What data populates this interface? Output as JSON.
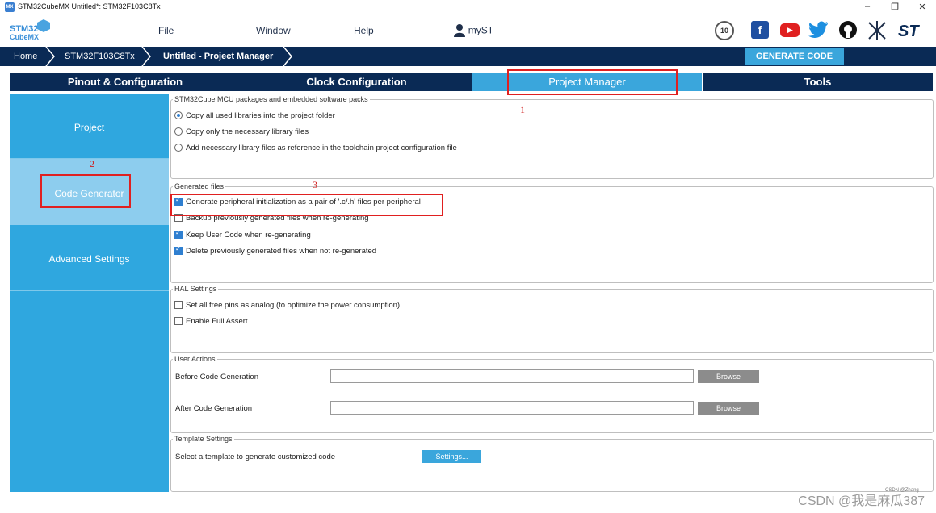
{
  "window": {
    "title": "STM32CubeMX Untitled*: STM32F103C8Tx",
    "app_icon": "MX",
    "controls": {
      "minimize": "–",
      "restore": "❐",
      "close": "✕"
    }
  },
  "menubar": {
    "logo_top": "STM32",
    "logo_bottom": "CubeMX",
    "items": [
      "File",
      "Window",
      "Help"
    ],
    "myst_label": "myST",
    "social_icons": [
      "anniversary-badge-icon",
      "facebook-icon",
      "youtube-icon",
      "twitter-icon",
      "github-icon",
      "network-icon",
      "st-logo-icon"
    ],
    "badge_text": "10"
  },
  "breadcrumb": {
    "items": [
      "Home",
      "STM32F103C8Tx",
      "Untitled - Project Manager"
    ]
  },
  "generate_button": "GENERATE CODE",
  "tabs": [
    {
      "label": "Pinout & Configuration",
      "active": false
    },
    {
      "label": "Clock Configuration",
      "active": false
    },
    {
      "label": "Project Manager",
      "active": true
    },
    {
      "label": "Tools",
      "active": false
    }
  ],
  "sidebar": {
    "items": [
      "Project",
      "Code Generator",
      "Advanced Settings"
    ],
    "active_index": 1
  },
  "packages": {
    "title": "STM32Cube MCU packages and embedded software packs",
    "options": [
      {
        "label": "Copy all used libraries into the project folder",
        "selected": true
      },
      {
        "label": "Copy only the necessary library files",
        "selected": false
      },
      {
        "label": "Add necessary library files as reference in the toolchain project configuration file",
        "selected": false
      }
    ]
  },
  "generated_files": {
    "title": "Generated files",
    "options": [
      {
        "label": "Generate peripheral initialization as a pair of '.c/.h' files per peripheral",
        "checked": true
      },
      {
        "label": "Backup previously generated files when re-generating",
        "checked": false
      },
      {
        "label": "Keep User Code when re-generating",
        "checked": true
      },
      {
        "label": "Delete previously generated files when not re-generated",
        "checked": true
      }
    ]
  },
  "hal_settings": {
    "title": "HAL Settings",
    "options": [
      {
        "label": "Set all free pins as analog (to optimize the power consumption)",
        "checked": false
      },
      {
        "label": "Enable Full Assert",
        "checked": false
      }
    ]
  },
  "user_actions": {
    "title": "User Actions",
    "before_label": "Before Code Generation",
    "before_value": "",
    "after_label": "After Code Generation",
    "after_value": "",
    "browse_label": "Browse"
  },
  "template_settings": {
    "title": "Template Settings",
    "label": "Select a template to generate customized code",
    "button": "Settings..."
  },
  "annotations": [
    "1",
    "2",
    "3"
  ],
  "watermark": "CSDN @我是麻瓜387",
  "watermark_small": "CSDN @Zhang",
  "colors": {
    "navy": "#0a2a55",
    "accent": "#3aa6dc",
    "sidebar": "#2fa7df",
    "annotation_red": "#e02020"
  }
}
